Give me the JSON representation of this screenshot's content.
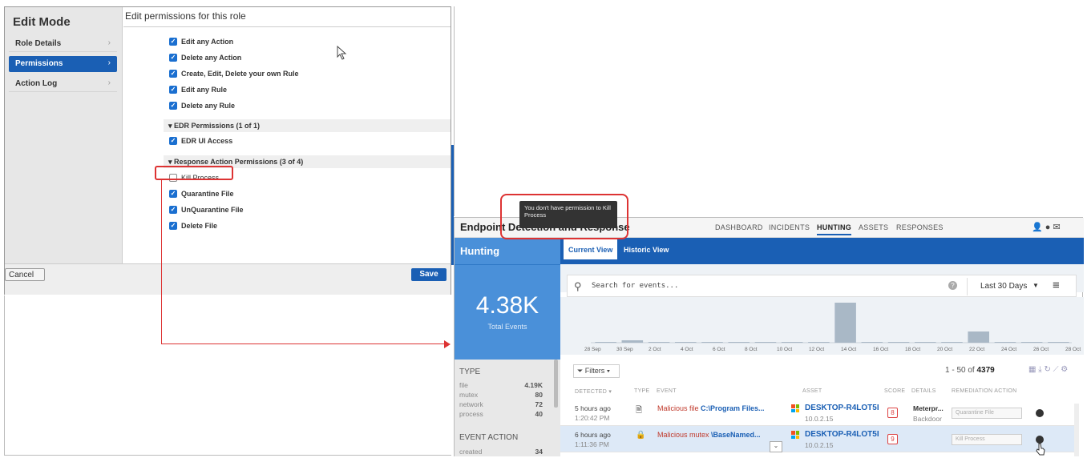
{
  "edit_mode": {
    "title": "Edit Mode",
    "sidebar": [
      {
        "label": "Role Details",
        "active": false
      },
      {
        "label": "Permissions",
        "active": true
      },
      {
        "label": "Action Log",
        "active": false
      }
    ],
    "header": "Edit permissions for this role",
    "permissions_top": [
      {
        "label": "Edit any Action",
        "checked": true
      },
      {
        "label": "Delete any Action",
        "checked": true
      },
      {
        "label": "Create, Edit, Delete your own Rule",
        "checked": true
      },
      {
        "label": "Edit any Rule",
        "checked": true
      },
      {
        "label": "Delete any Rule",
        "checked": true
      }
    ],
    "edr_group": "▾ EDR Permissions (1 of 1)",
    "edr_items": [
      {
        "label": "EDR UI Access",
        "checked": true
      }
    ],
    "response_group": "▾ Response Action Permissions (3 of 4)",
    "response_items": [
      {
        "label": "Kill Process",
        "checked": false
      },
      {
        "label": "Quarantine File",
        "checked": true
      },
      {
        "label": "UnQuarantine File",
        "checked": true
      },
      {
        "label": "Delete File",
        "checked": true
      }
    ],
    "cancel_label": "Cancel",
    "save_label": "Save"
  },
  "edr": {
    "title": "Endpoint Detection and Response",
    "nav": [
      "DASHBOARD",
      "INCIDENTS",
      "HUNTING",
      "ASSETS",
      "RESPONSES"
    ],
    "active_nav": "HUNTING",
    "section_title": "Hunting",
    "total_value": "4.38K",
    "total_label": "Total Events",
    "tabs": [
      "Current View",
      "Historic View"
    ],
    "search_placeholder": "Search for events...",
    "time_range": "Last 30 Days",
    "chart_ticks": [
      "28 Sep",
      "30 Sep",
      "2 Oct",
      "4 Oct",
      "6 Oct",
      "8 Oct",
      "10 Oct",
      "12 Oct",
      "14 Oct",
      "16 Oct",
      "18 Oct",
      "20 Oct",
      "22 Oct",
      "24 Oct",
      "26 Oct",
      "28 Oct"
    ],
    "filters_label": "Filters",
    "count_prefix": "1 - 50 of",
    "count_total": "4379",
    "facets": {
      "type_header": "TYPE",
      "type_rows": [
        {
          "label": "file",
          "value": "4.19K"
        },
        {
          "label": "mutex",
          "value": "80"
        },
        {
          "label": "network",
          "value": "72"
        },
        {
          "label": "process",
          "value": "40"
        }
      ],
      "action_header": "EVENT ACTION",
      "action_rows": [
        {
          "label": "created",
          "value": "34"
        }
      ]
    },
    "columns": [
      "DETECTED ▾",
      "TYPE",
      "EVENT",
      "ASSET",
      "SCORE",
      "DETAILS",
      "REMEDIATION ACTION"
    ],
    "rows": [
      {
        "detected": "5 hours ago",
        "time": "1:20:42 PM",
        "event_prefix": "Malicious file ",
        "event_target": "C:\\Program Files...",
        "asset": "DESKTOP-R4LOT5I",
        "ip": "10.0.2.15",
        "score": "8",
        "details": "Meterpr...",
        "details_sub": "Backdoor",
        "remediation": "Quarantine File"
      },
      {
        "detected": "6 hours ago",
        "time": "1:11:36 PM",
        "event_prefix": "Malicious mutex ",
        "event_target": "\\BaseNamed...",
        "asset": "DESKTOP-R4LOT5I",
        "ip": "10.0.2.15",
        "score": "9",
        "details": "",
        "details_sub": "",
        "remediation": "Kill Process"
      }
    ],
    "tooltip": "You don't have permission to Kill Process"
  },
  "chart_data": {
    "type": "bar",
    "categories": [
      "28 Sep",
      "30 Sep",
      "2 Oct",
      "4 Oct",
      "6 Oct",
      "8 Oct",
      "10 Oct",
      "12 Oct",
      "14 Oct",
      "16 Oct",
      "18 Oct",
      "20 Oct",
      "22 Oct",
      "24 Oct",
      "26 Oct",
      "28 Oct"
    ],
    "values": [
      1,
      3,
      1,
      1,
      1,
      1,
      1,
      1,
      1,
      50,
      1,
      1,
      1,
      1,
      14,
      1,
      1,
      1
    ],
    "colors": {
      "bar": "#a9b8c6",
      "accent": "#1a5fb4"
    }
  }
}
